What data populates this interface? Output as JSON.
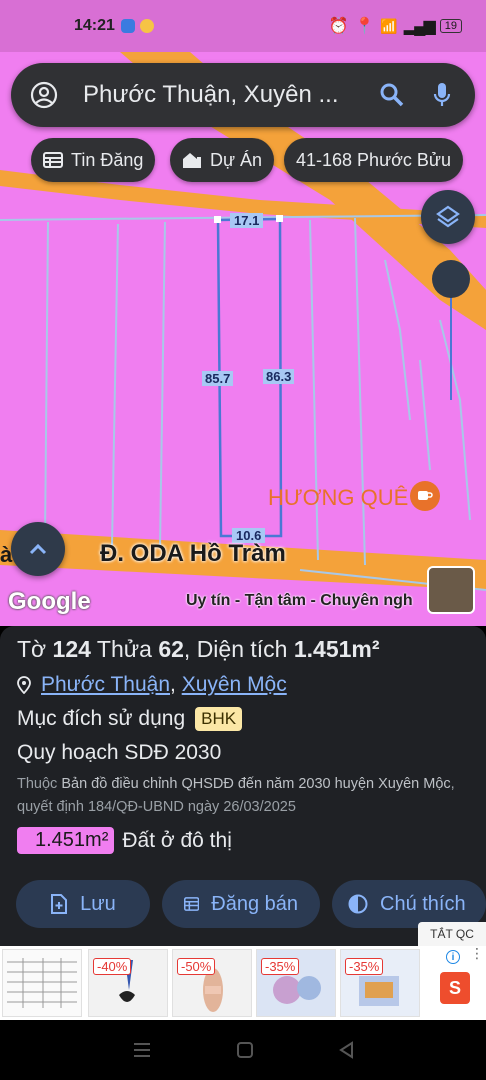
{
  "status": {
    "time": "14:21",
    "battery": "19"
  },
  "search": {
    "query": "Phước Thuận, Xuyên ..."
  },
  "chips": [
    {
      "label": "Tin Đăng"
    },
    {
      "label": "Dự Án"
    },
    {
      "label": "41-168 Phước Bửu"
    }
  ],
  "map": {
    "dimensions": {
      "top": "17.1",
      "left": "85.7",
      "right": "86.3",
      "bottom": "10.6"
    },
    "poi": "HƯƠNG QUÊ",
    "road": "Đ. ODA Hồ Tràm",
    "road_prefix": "à",
    "watermark": "Google",
    "ad_text": "Uy tín - Tận tâm - Chuyên ngh"
  },
  "info": {
    "to_label": "Tờ",
    "to": "124",
    "thua_label": "Thửa",
    "thua": "62",
    "dientich_label": "Diện tích",
    "area": "1.451m²",
    "ward": "Phước Thuận",
    "district": "Xuyên Mộc",
    "purpose_label": "Mục đích sử dụng",
    "purpose_code": "BHK",
    "plan": "Quy hoạch SDĐ 2030",
    "desc_prefix": "Thuộc",
    "desc_main": "Bản đồ điều chỉnh QHSDĐ đến năm 2030 huyện Xuyên Mộc",
    "desc_suffix": ", quyết định 184/QĐ-UBND ngày 26/03/2025",
    "area_badge": "1.451m²",
    "land_type": "Đất ở đô thị"
  },
  "actions": [
    {
      "label": "Lưu"
    },
    {
      "label": "Đăng bán"
    },
    {
      "label": "Chú thích"
    }
  ],
  "ad": {
    "tag": "TẮT QC",
    "discounts": [
      "-40%",
      "-50%",
      "-35%",
      "-35%"
    ]
  },
  "colors": {
    "map_pink": "#f07ef0",
    "road_orange": "#f4a23a",
    "accent_blue": "#8ab4f8",
    "panel_bg": "#1f2125"
  }
}
